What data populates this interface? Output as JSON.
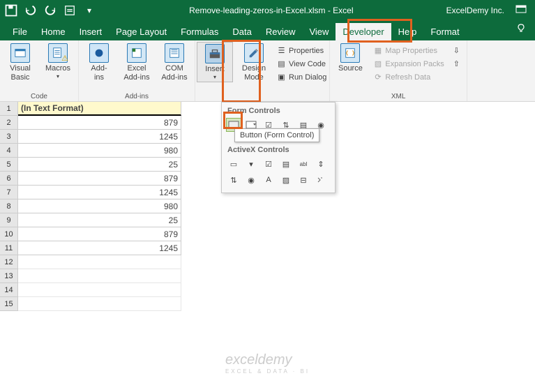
{
  "titlebar": {
    "doc": "Remove-leading-zeros-in-Excel.xlsm - Excel",
    "account": "ExcelDemy Inc."
  },
  "tabs": {
    "file": "File",
    "home": "Home",
    "insert": "Insert",
    "page_layout": "Page Layout",
    "formulas": "Formulas",
    "data": "Data",
    "review": "Review",
    "view": "View",
    "developer": "Developer",
    "help": "Help",
    "format": "Format"
  },
  "ribbon": {
    "code": {
      "visual_basic": "Visual\nBasic",
      "macros": "Macros",
      "label": "Code"
    },
    "addins": {
      "addins": "Add-\nins",
      "excel_addins": "Excel\nAdd-ins",
      "com_addins": "COM\nAdd-ins",
      "label": "Add-ins"
    },
    "controls": {
      "insert": "Insert",
      "design_mode": "Design\nMode",
      "properties": "Properties",
      "view_code": "View Code",
      "run_dialog": "Run Dialog"
    },
    "xml": {
      "source": "Source",
      "map_props": "Map Properties",
      "expansion_packs": "Expansion Packs",
      "refresh_data": "Refresh Data",
      "label": "XML"
    }
  },
  "dropdown": {
    "form_controls": "Form Controls",
    "activex_controls": "ActiveX Controls",
    "tooltip": "Button (Form Control)"
  },
  "sheet": {
    "header_cell": "(In Text Format)",
    "rows": [
      {
        "n": "1"
      },
      {
        "n": "2",
        "v": "879"
      },
      {
        "n": "3",
        "v": "1245"
      },
      {
        "n": "4",
        "v": "980"
      },
      {
        "n": "5",
        "v": "25"
      },
      {
        "n": "6",
        "v": "879"
      },
      {
        "n": "7",
        "v": "1245"
      },
      {
        "n": "8",
        "v": "980"
      },
      {
        "n": "9",
        "v": "25"
      },
      {
        "n": "10",
        "v": "879"
      },
      {
        "n": "11",
        "v": "1245"
      },
      {
        "n": "12"
      },
      {
        "n": "13"
      },
      {
        "n": "14"
      },
      {
        "n": "15"
      }
    ]
  },
  "watermark": {
    "main": "exceldemy",
    "sub": "EXCEL & DATA · BI"
  }
}
